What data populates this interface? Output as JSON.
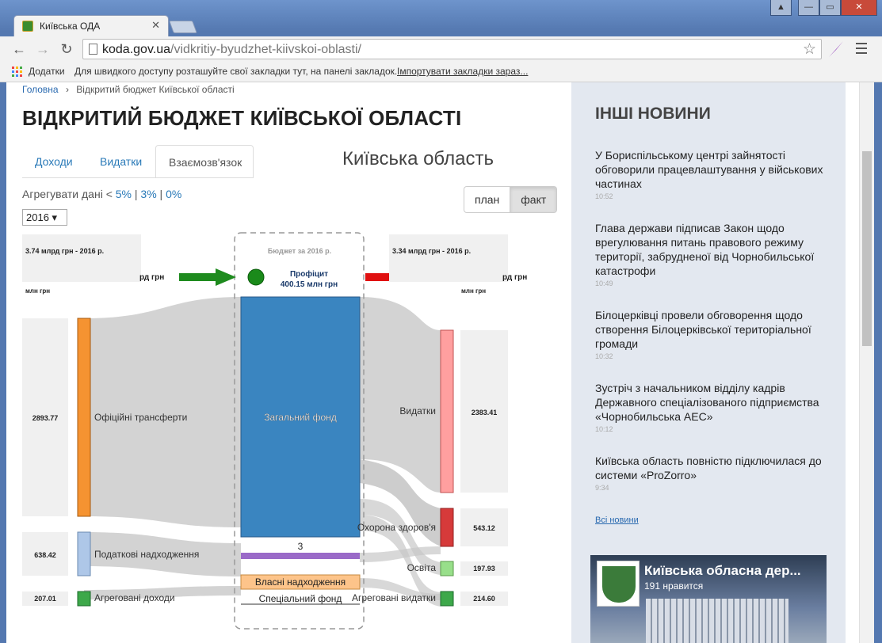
{
  "browser": {
    "tab_title": "Київська ОДА",
    "url_domain": "koda.gov.ua",
    "url_path": "/vidkritiy-byudzhet-kiivskoi-oblasti/",
    "bookmarks_apps": "Додатки",
    "bookmarks_hint": "Для швидкого доступу розташуйте свої закладки тут, на панелі закладок.",
    "bookmarks_import": "Імпортувати закладки зараз..."
  },
  "breadcrumb": {
    "home": "Головна",
    "sep": "›",
    "current": "Відкритий бюджет Київської області"
  },
  "page_title": "ВІДКРИТИЙ БЮДЖЕТ КИЇВСЬКОЇ ОБЛАСТІ",
  "tabs": [
    {
      "label": "Доходи"
    },
    {
      "label": "Видатки"
    },
    {
      "label": "Взаємозв'язок"
    }
  ],
  "region": "Київська область",
  "aggregate": {
    "label": "Агрегувати дані <",
    "opt1": "5%",
    "sep1": "|",
    "opt2": "3%",
    "sep2": "|",
    "opt3": "0%"
  },
  "mode": {
    "plan": "план",
    "fact": "факт"
  },
  "year": "2016 ▾",
  "sankey": {
    "budget_title": "Бюджет за 2016 р.",
    "left_total": "3.74 млрд грн - 2016 р.",
    "right_total": "3.34 млрд грн - 2016 р.",
    "left_hidden": "рд грн",
    "right_hidden": "рд грн",
    "unit_left": "млн грн",
    "unit_right": "млн грн",
    "surplus_label": "Профіцит",
    "surplus_value": "400.15 млн грн",
    "general_fund": "Загальний фонд",
    "small_node": "3",
    "own_revenue": "Власні надходження",
    "special_fund": "Спеціальний фонд",
    "income": [
      {
        "label": "Офіційні трансферти",
        "value": "2893.77",
        "color": "#f59331"
      },
      {
        "label": "Податкові надходження",
        "value": "638.42",
        "color": "#aec7e8"
      },
      {
        "label": "Агреговані доходи",
        "value": "207.01",
        "color": "#3da84a"
      }
    ],
    "expense": [
      {
        "label": "Видатки",
        "value": "2383.41",
        "color": "#ff9f9f"
      },
      {
        "label": "Охорона здоров'я",
        "value": "543.12",
        "color": "#d63a3a"
      },
      {
        "label": "Освіта",
        "value": "197.93",
        "color": "#98df8a"
      },
      {
        "label": "Агреговані видатки",
        "value": "214.60",
        "color": "#3da84a"
      }
    ]
  },
  "sidebar": {
    "title": "ІНШІ НОВИНИ",
    "news": [
      {
        "text": "У Бориспільському центрі зайнятості обговорили працевлаштування у військових частинах",
        "time": "10:52"
      },
      {
        "text": "Глава держави підписав Закон щодо врегулювання питань правового режиму території, забрудненої від Чорнобильської катастрофи",
        "time": "10:49"
      },
      {
        "text": "Білоцерківці провели обговорення щодо створення Білоцерківської територіальної громади",
        "time": "10:32"
      },
      {
        "text": "Зустріч з начальником відділу кадрів Державного спеціалізованого підприємства «Чорнобильська АЕС»",
        "time": "10:12"
      },
      {
        "text": "Київська область повністю підключилася до системи «ProZorro»",
        "time": "9:34"
      }
    ],
    "all_news": "Всі новини",
    "fb_title": "Київська обласна дер...",
    "fb_likes": "191 нравится"
  }
}
